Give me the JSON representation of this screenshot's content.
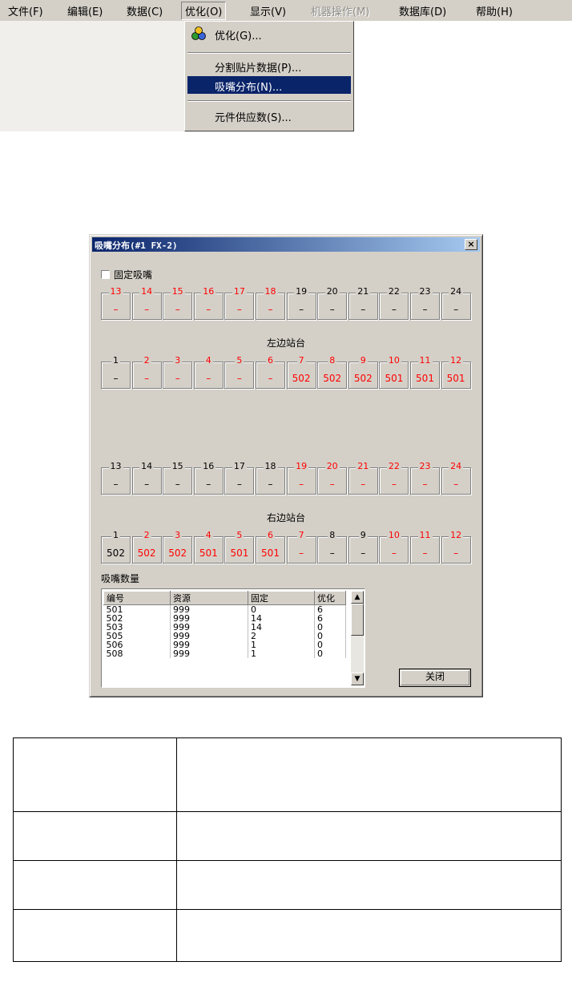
{
  "menubar": {
    "items": [
      "文件(F)",
      "编辑(E)",
      "数据(C)",
      "优化(O)",
      "显示(V)",
      "机器操作(M)",
      "数据库(D)",
      "帮助(H)"
    ]
  },
  "dropdown": {
    "items": [
      "优化(G)...",
      "分割贴片数据(P)...",
      "吸嘴分布(N)...",
      "元件供应数(S)..."
    ],
    "selected_index": 2,
    "icon": "optimize-icon"
  },
  "dialog": {
    "title": "吸嘴分布(#1 FX-2)",
    "close_glyph": "×",
    "fixed_nozzle_label": "固定吸嘴",
    "left_station_label": "左边站台",
    "right_station_label": "右边站台",
    "nozzle_count_label": "吸嘴数量",
    "close_button": "关闭",
    "left_rear": [
      {
        "n": "13",
        "v": "–",
        "c": "red"
      },
      {
        "n": "14",
        "v": "–",
        "c": "red"
      },
      {
        "n": "15",
        "v": "–",
        "c": "red"
      },
      {
        "n": "16",
        "v": "–",
        "c": "red"
      },
      {
        "n": "17",
        "v": "–",
        "c": "red"
      },
      {
        "n": "18",
        "v": "–",
        "c": "red"
      },
      {
        "n": "19",
        "v": "–",
        "c": "blk"
      },
      {
        "n": "20",
        "v": "–",
        "c": "blk"
      },
      {
        "n": "21",
        "v": "–",
        "c": "blk"
      },
      {
        "n": "22",
        "v": "–",
        "c": "blk"
      },
      {
        "n": "23",
        "v": "–",
        "c": "blk"
      },
      {
        "n": "24",
        "v": "–",
        "c": "blk"
      }
    ],
    "left_front": [
      {
        "n": "1",
        "v": "–",
        "c": "blk"
      },
      {
        "n": "2",
        "v": "–",
        "c": "red"
      },
      {
        "n": "3",
        "v": "–",
        "c": "red"
      },
      {
        "n": "4",
        "v": "–",
        "c": "red"
      },
      {
        "n": "5",
        "v": "–",
        "c": "red"
      },
      {
        "n": "6",
        "v": "–",
        "c": "red"
      },
      {
        "n": "7",
        "v": "502",
        "c": "red"
      },
      {
        "n": "8",
        "v": "502",
        "c": "red"
      },
      {
        "n": "9",
        "v": "502",
        "c": "red"
      },
      {
        "n": "10",
        "v": "501",
        "c": "red"
      },
      {
        "n": "11",
        "v": "501",
        "c": "red"
      },
      {
        "n": "12",
        "v": "501",
        "c": "red"
      }
    ],
    "right_rear": [
      {
        "n": "13",
        "v": "–",
        "c": "blk"
      },
      {
        "n": "14",
        "v": "–",
        "c": "blk"
      },
      {
        "n": "15",
        "v": "–",
        "c": "blk"
      },
      {
        "n": "16",
        "v": "–",
        "c": "blk"
      },
      {
        "n": "17",
        "v": "–",
        "c": "blk"
      },
      {
        "n": "18",
        "v": "–",
        "c": "blk"
      },
      {
        "n": "19",
        "v": "–",
        "c": "red"
      },
      {
        "n": "20",
        "v": "–",
        "c": "red"
      },
      {
        "n": "21",
        "v": "–",
        "c": "red"
      },
      {
        "n": "22",
        "v": "–",
        "c": "red"
      },
      {
        "n": "23",
        "v": "–",
        "c": "red"
      },
      {
        "n": "24",
        "v": "–",
        "c": "red"
      }
    ],
    "right_front": [
      {
        "n": "1",
        "v": "502",
        "c": "blk"
      },
      {
        "n": "2",
        "v": "502",
        "c": "red"
      },
      {
        "n": "3",
        "v": "502",
        "c": "red"
      },
      {
        "n": "4",
        "v": "501",
        "c": "red"
      },
      {
        "n": "5",
        "v": "501",
        "c": "red"
      },
      {
        "n": "6",
        "v": "501",
        "c": "red"
      },
      {
        "n": "7",
        "v": "–",
        "c": "red"
      },
      {
        "n": "8",
        "v": "–",
        "c": "blk"
      },
      {
        "n": "9",
        "v": "–",
        "c": "blk"
      },
      {
        "n": "10",
        "v": "–",
        "c": "red"
      },
      {
        "n": "11",
        "v": "–",
        "c": "red"
      },
      {
        "n": "12",
        "v": "–",
        "c": "red"
      }
    ],
    "table": {
      "columns": [
        "编号",
        "资源",
        "固定",
        "优化"
      ],
      "rows": [
        [
          "501",
          "999",
          "0",
          "6"
        ],
        [
          "502",
          "999",
          "14",
          "6"
        ],
        [
          "503",
          "999",
          "14",
          "0"
        ],
        [
          "505",
          "999",
          "2",
          "0"
        ],
        [
          "506",
          "999",
          "1",
          "0"
        ],
        [
          "508",
          "999",
          "1",
          "0"
        ]
      ]
    }
  },
  "colors": {
    "active": "#ff0000",
    "inactive": "#000000",
    "selection": "#0a246a",
    "face": "#d4d0c8"
  }
}
